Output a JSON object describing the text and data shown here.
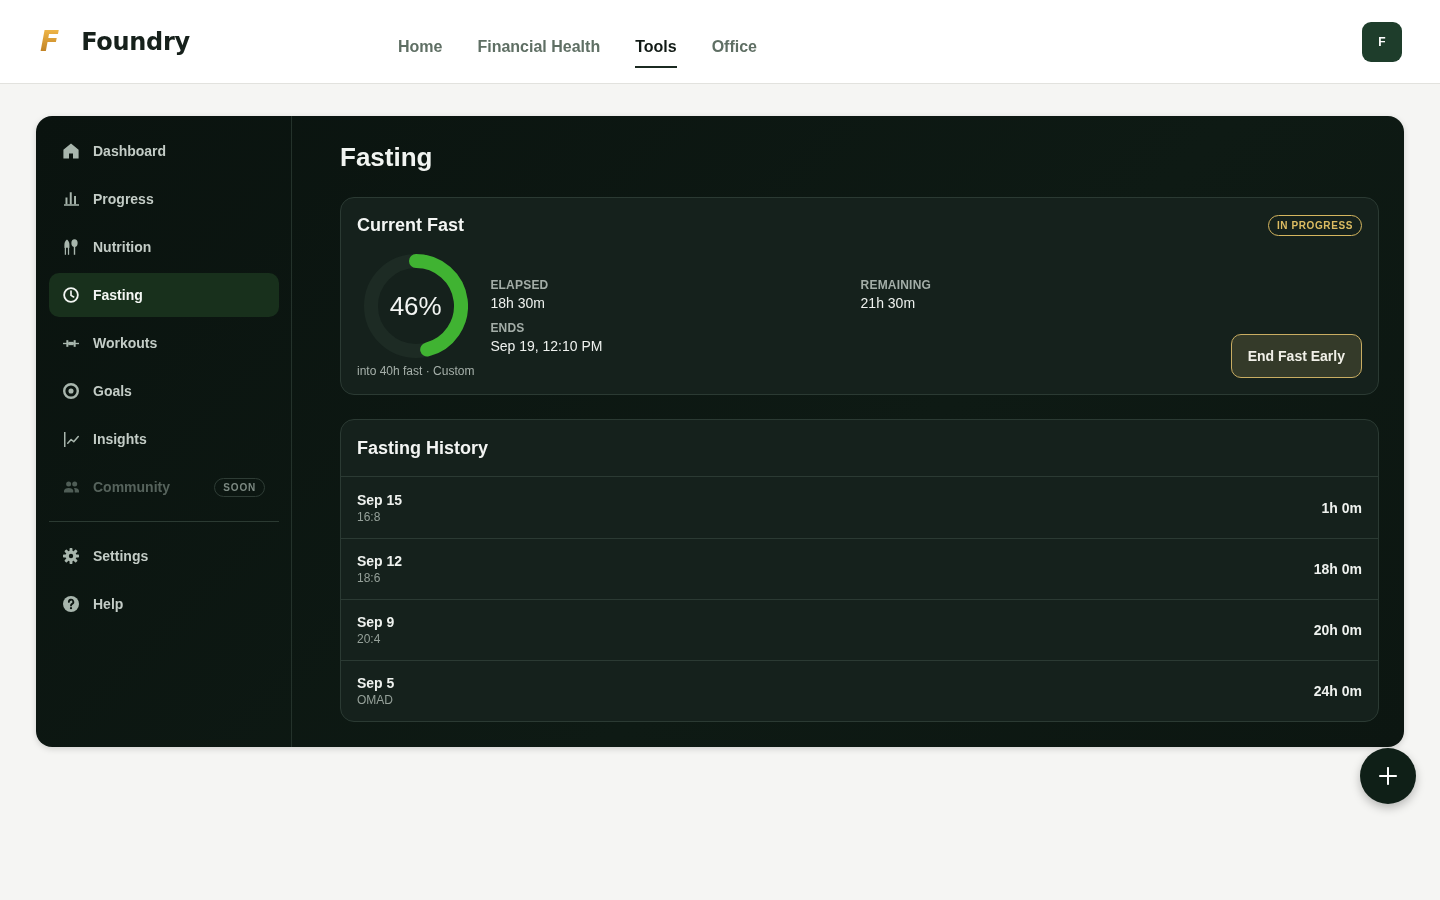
{
  "header": {
    "logo": "F",
    "brand": "Foundry",
    "nav": [
      {
        "label": "Home",
        "selected": false
      },
      {
        "label": "Financial Health",
        "selected": false
      },
      {
        "label": "Tools",
        "selected": true
      },
      {
        "label": "Office",
        "selected": false
      }
    ],
    "avatar": "F"
  },
  "sidebar": {
    "items": [
      {
        "label": "Dashboard",
        "selected": false,
        "disabled": false
      },
      {
        "label": "Progress",
        "selected": false,
        "disabled": false
      },
      {
        "label": "Nutrition",
        "selected": false,
        "disabled": false
      },
      {
        "label": "Fasting",
        "selected": true,
        "disabled": false
      },
      {
        "label": "Workouts",
        "selected": false,
        "disabled": false
      },
      {
        "label": "Goals",
        "selected": false,
        "disabled": false
      },
      {
        "label": "Insights",
        "selected": false,
        "disabled": false
      },
      {
        "label": "Community",
        "selected": false,
        "disabled": true,
        "badge": "SOON"
      }
    ],
    "footer_items": [
      {
        "label": "Settings",
        "selected": false
      },
      {
        "label": "Help",
        "selected": false
      }
    ]
  },
  "page_title": "Fasting",
  "current_fast": {
    "title": "Current Fast",
    "status": "IN PROGRESS",
    "progress": {
      "level": 0.46,
      "label": "46%"
    },
    "caption": "into 40h fast · Custom",
    "stats": [
      {
        "label": "ELAPSED",
        "value": "18h 30m"
      },
      {
        "label": "REMAINING",
        "value": "21h 30m"
      },
      {
        "label": "ENDS",
        "value": "Sep 19, 12:10 PM"
      }
    ],
    "action": "End Fast Early"
  },
  "history": {
    "title": "Fasting History",
    "rows": [
      {
        "date": "Sep 15",
        "protocol": "16:8",
        "duration": "1h 0m"
      },
      {
        "date": "Sep 12",
        "protocol": "18:6",
        "duration": "18h 0m"
      },
      {
        "date": "Sep 9",
        "protocol": "20:4",
        "duration": "20h 0m"
      },
      {
        "date": "Sep 5",
        "protocol": "OMAD",
        "duration": "24h 0m"
      }
    ]
  }
}
